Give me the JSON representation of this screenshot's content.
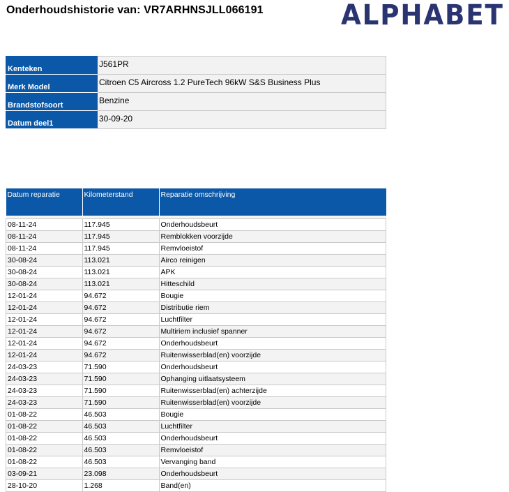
{
  "header": {
    "title": "Onderhoudshistorie van: VR7ARHNSJLL066191",
    "logo": "ALPHABET"
  },
  "vehicle": [
    {
      "label": "Kenteken",
      "value": "J561PR"
    },
    {
      "label": "Merk Model",
      "value": "Citroen C5 Aircross 1.2 PureTech 96kW S&S Business Plus"
    },
    {
      "label": "Brandstofsoort",
      "value": "Benzine"
    },
    {
      "label": "Datum deel1",
      "value": "30-09-20"
    }
  ],
  "history": {
    "columns": [
      "Datum reparatie",
      "Kilometerstand",
      "Reparatie omschrijving"
    ],
    "rows": [
      [
        "08-11-24",
        "117.945",
        "Onderhoudsbeurt"
      ],
      [
        "08-11-24",
        "117.945",
        "Remblokken voorzijde"
      ],
      [
        "08-11-24",
        "117.945",
        "Remvloeistof"
      ],
      [
        "30-08-24",
        "113.021",
        "Airco reinigen"
      ],
      [
        "30-08-24",
        "113.021",
        "APK"
      ],
      [
        "30-08-24",
        "113.021",
        "Hitteschild"
      ],
      [
        "12-01-24",
        "94.672",
        "Bougie"
      ],
      [
        "12-01-24",
        "94.672",
        "Distributie riem"
      ],
      [
        "12-01-24",
        "94.672",
        "Luchtfilter"
      ],
      [
        "12-01-24",
        "94.672",
        "Multiriem inclusief spanner"
      ],
      [
        "12-01-24",
        "94.672",
        "Onderhoudsbeurt"
      ],
      [
        "12-01-24",
        "94.672",
        "Ruitenwisserblad(en) voorzijde"
      ],
      [
        "24-03-23",
        "71.590",
        "Onderhoudsbeurt"
      ],
      [
        "24-03-23",
        "71.590",
        "Ophanging uitlaatsysteem"
      ],
      [
        "24-03-23",
        "71.590",
        "Ruitenwisserblad(en) achterzijde"
      ],
      [
        "24-03-23",
        "71.590",
        "Ruitenwisserblad(en) voorzijde"
      ],
      [
        "01-08-22",
        "46.503",
        "Bougie"
      ],
      [
        "01-08-22",
        "46.503",
        "Luchtfilter"
      ],
      [
        "01-08-22",
        "46.503",
        "Onderhoudsbeurt"
      ],
      [
        "01-08-22",
        "46.503",
        "Remvloeistof"
      ],
      [
        "01-08-22",
        "46.503",
        "Vervanging band"
      ],
      [
        "03-09-21",
        "23.098",
        "Onderhoudsbeurt"
      ],
      [
        "28-10-20",
        "1.268",
        "Band(en)"
      ]
    ]
  },
  "colors": {
    "header_blue": "#0b58a8",
    "logo_navy": "#2a3470"
  }
}
